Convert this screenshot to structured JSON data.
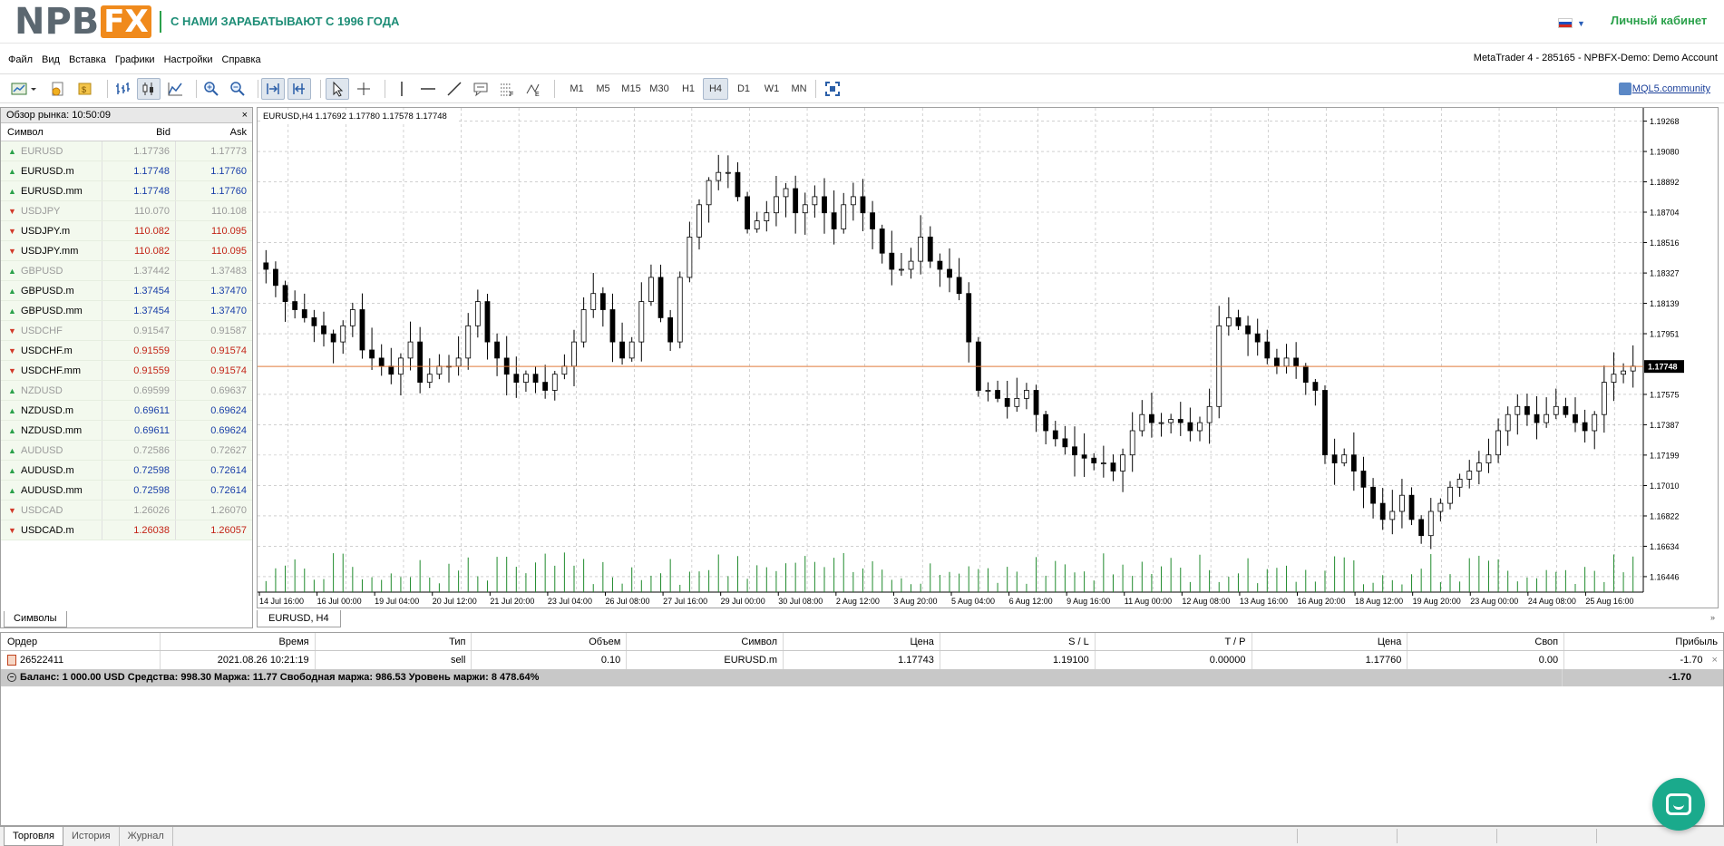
{
  "header": {
    "logo_part1": "NPB",
    "logo_part2": "FX",
    "slogan": "С НАМИ ЗАРАБАТЫВАЮТ С 1996 ГОДА",
    "cabinet_link": "Личный кабинет",
    "flag_colors": [
      "#ffffff",
      "#1d4fbf",
      "#d52b1e"
    ]
  },
  "menu": {
    "items": [
      "Файл",
      "Вид",
      "Вставка",
      "Графики",
      "Настройки",
      "Справка"
    ],
    "window_title": "MetaTrader 4 - 285165 - NPBFX-Demo: Demo Account"
  },
  "toolbar": {
    "timeframes": [
      "M1",
      "M5",
      "M15",
      "M30",
      "H1",
      "H4",
      "D1",
      "W1",
      "MN"
    ],
    "active_timeframe": "H4",
    "mql5_link": "MQL5.community"
  },
  "market_watch": {
    "title": "Обзор рынка: 10:50:09",
    "col_symbol": "Символ",
    "col_bid": "Bid",
    "col_ask": "Ask",
    "tab": "Символы",
    "rows": [
      {
        "symbol": "EURUSD",
        "bid": "1.17736",
        "ask": "1.17773",
        "dir": "up",
        "muted": true,
        "bid_color": "grey",
        "ask_color": "grey"
      },
      {
        "symbol": "EURUSD.m",
        "bid": "1.17748",
        "ask": "1.17760",
        "dir": "up",
        "muted": false,
        "bid_color": "blue",
        "ask_color": "blue"
      },
      {
        "symbol": "EURUSD.mm",
        "bid": "1.17748",
        "ask": "1.17760",
        "dir": "up",
        "muted": false,
        "bid_color": "blue",
        "ask_color": "blue"
      },
      {
        "symbol": "USDJPY",
        "bid": "110.070",
        "ask": "110.108",
        "dir": "down",
        "muted": true,
        "bid_color": "grey",
        "ask_color": "grey"
      },
      {
        "symbol": "USDJPY.m",
        "bid": "110.082",
        "ask": "110.095",
        "dir": "down",
        "muted": false,
        "bid_color": "red",
        "ask_color": "red"
      },
      {
        "symbol": "USDJPY.mm",
        "bid": "110.082",
        "ask": "110.095",
        "dir": "down",
        "muted": false,
        "bid_color": "red",
        "ask_color": "red"
      },
      {
        "symbol": "GBPUSD",
        "bid": "1.37442",
        "ask": "1.37483",
        "dir": "up",
        "muted": true,
        "bid_color": "grey",
        "ask_color": "grey"
      },
      {
        "symbol": "GBPUSD.m",
        "bid": "1.37454",
        "ask": "1.37470",
        "dir": "up",
        "muted": false,
        "bid_color": "blue",
        "ask_color": "blue"
      },
      {
        "symbol": "GBPUSD.mm",
        "bid": "1.37454",
        "ask": "1.37470",
        "dir": "up",
        "muted": false,
        "bid_color": "blue",
        "ask_color": "blue"
      },
      {
        "symbol": "USDCHF",
        "bid": "0.91547",
        "ask": "0.91587",
        "dir": "down",
        "muted": true,
        "bid_color": "grey",
        "ask_color": "grey"
      },
      {
        "symbol": "USDCHF.m",
        "bid": "0.91559",
        "ask": "0.91574",
        "dir": "down",
        "muted": false,
        "bid_color": "red",
        "ask_color": "red"
      },
      {
        "symbol": "USDCHF.mm",
        "bid": "0.91559",
        "ask": "0.91574",
        "dir": "down",
        "muted": false,
        "bid_color": "red",
        "ask_color": "red"
      },
      {
        "symbol": "NZDUSD",
        "bid": "0.69599",
        "ask": "0.69637",
        "dir": "up",
        "muted": true,
        "bid_color": "grey",
        "ask_color": "grey"
      },
      {
        "symbol": "NZDUSD.m",
        "bid": "0.69611",
        "ask": "0.69624",
        "dir": "up",
        "muted": false,
        "bid_color": "blue",
        "ask_color": "blue"
      },
      {
        "symbol": "NZDUSD.mm",
        "bid": "0.69611",
        "ask": "0.69624",
        "dir": "up",
        "muted": false,
        "bid_color": "blue",
        "ask_color": "blue"
      },
      {
        "symbol": "AUDUSD",
        "bid": "0.72586",
        "ask": "0.72627",
        "dir": "up",
        "muted": true,
        "bid_color": "grey",
        "ask_color": "grey"
      },
      {
        "symbol": "AUDUSD.m",
        "bid": "0.72598",
        "ask": "0.72614",
        "dir": "up",
        "muted": false,
        "bid_color": "blue",
        "ask_color": "blue"
      },
      {
        "symbol": "AUDUSD.mm",
        "bid": "0.72598",
        "ask": "0.72614",
        "dir": "up",
        "muted": false,
        "bid_color": "blue",
        "ask_color": "blue"
      },
      {
        "symbol": "USDCAD",
        "bid": "1.26026",
        "ask": "1.26070",
        "dir": "down",
        "muted": true,
        "bid_color": "grey",
        "ask_color": "grey"
      },
      {
        "symbol": "USDCAD.m",
        "bid": "1.26038",
        "ask": "1.26057",
        "dir": "down",
        "muted": false,
        "bid_color": "red",
        "ask_color": "red"
      }
    ]
  },
  "chart": {
    "info": "EURUSD,H4  1.17692 1.17780 1.17578 1.17748",
    "tab": "EURUSD, H4",
    "current_price": "1.17748",
    "current_price_value": 1.17748,
    "price_labels": [
      "1.19268",
      "1.19080",
      "1.18892",
      "1.18704",
      "1.18516",
      "1.18327",
      "1.18139",
      "1.17951",
      "1.17575",
      "1.17387",
      "1.17199",
      "1.17010",
      "1.16822",
      "1.16634",
      "1.16446"
    ],
    "price_range": [
      1.1635,
      1.1935
    ],
    "time_labels": [
      "14 Jul 16:00",
      "16 Jul 00:00",
      "19 Jul 04:00",
      "20 Jul 12:00",
      "21 Jul 20:00",
      "23 Jul 04:00",
      "26 Jul 08:00",
      "27 Jul 16:00",
      "29 Jul 00:00",
      "30 Jul 08:00",
      "2 Aug 12:00",
      "3 Aug 20:00",
      "5 Aug 04:00",
      "6 Aug 12:00",
      "9 Aug 16:00",
      "11 Aug 00:00",
      "12 Aug 08:00",
      "13 Aug 16:00",
      "16 Aug 20:00",
      "18 Aug 12:00",
      "19 Aug 20:00",
      "23 Aug 00:00",
      "24 Aug 08:00",
      "25 Aug 16:00"
    ],
    "colors": {
      "grid": "#b4b4b4",
      "price_line": "#e07a3a",
      "volume": "#1f8a2c",
      "candle": "#000000",
      "label_bg": "#000000"
    }
  },
  "chart_data": {
    "type": "candlestick",
    "symbol": "EURUSD",
    "timeframe": "H4",
    "close_path": [
      1.1835,
      1.1825,
      1.1815,
      1.181,
      1.1805,
      1.18,
      1.1795,
      1.179,
      1.18,
      1.181,
      1.1785,
      1.178,
      1.1775,
      1.177,
      1.178,
      1.179,
      1.1765,
      1.177,
      1.1775,
      1.1775,
      1.178,
      1.18,
      1.1815,
      1.179,
      1.178,
      1.177,
      1.1765,
      1.177,
      1.1765,
      1.176,
      1.177,
      1.1775,
      1.179,
      1.181,
      1.182,
      1.181,
      1.179,
      1.178,
      1.179,
      1.1815,
      1.183,
      1.1805,
      1.179,
      1.183,
      1.1855,
      1.1875,
      1.189,
      1.1895,
      1.1895,
      1.188,
      1.186,
      1.1865,
      1.187,
      1.188,
      1.1885,
      1.187,
      1.1875,
      1.188,
      1.187,
      1.186,
      1.1875,
      1.188,
      1.187,
      1.186,
      1.1845,
      1.1835,
      1.1835,
      1.184,
      1.1855,
      1.184,
      1.1835,
      1.183,
      1.182,
      1.179,
      1.176,
      1.176,
      1.1755,
      1.175,
      1.1755,
      1.176,
      1.1745,
      1.1735,
      1.173,
      1.1725,
      1.172,
      1.1718,
      1.1715,
      1.1715,
      1.171,
      1.172,
      1.1735,
      1.1745,
      1.174,
      1.174,
      1.1742,
      1.174,
      1.1735,
      1.174,
      1.175,
      1.18,
      1.1805,
      1.18,
      1.1795,
      1.179,
      1.178,
      1.1775,
      1.178,
      1.1775,
      1.1765,
      1.176,
      1.172,
      1.1715,
      1.172,
      1.171,
      1.17,
      1.169,
      1.168,
      1.1685,
      1.1695,
      1.168,
      1.167,
      1.1685,
      1.169,
      1.17,
      1.1705,
      1.171,
      1.1715,
      1.172,
      1.1735,
      1.1745,
      1.175,
      1.1745,
      1.174,
      1.1745,
      1.175,
      1.1745,
      1.174,
      1.1735,
      1.1745,
      1.1765,
      1.177,
      1.1772,
      1.1775
    ]
  },
  "terminal": {
    "headers": [
      "Ордер",
      "Время",
      "Тип",
      "Объем",
      "Символ",
      "Цена",
      "S / L",
      "T / P",
      "Цена",
      "Своп",
      "Прибыль"
    ],
    "order": {
      "id": "26522411",
      "time": "2021.08.26 10:21:19",
      "type": "sell",
      "volume": "0.10",
      "symbol": "EURUSD.m",
      "price": "1.17743",
      "sl": "1.19100",
      "tp": "0.00000",
      "cur_price": "1.17760",
      "swap": "0.00",
      "profit": "-1.70"
    },
    "balance_line": "Баланс: 1 000.00 USD  Средства: 998.30  Маржа: 11.77  Свободная маржа: 986.53  Уровень маржи: 8 478.64%",
    "balance_profit": "-1.70",
    "tabs": [
      "Торговля",
      "История",
      "Журнал"
    ]
  }
}
